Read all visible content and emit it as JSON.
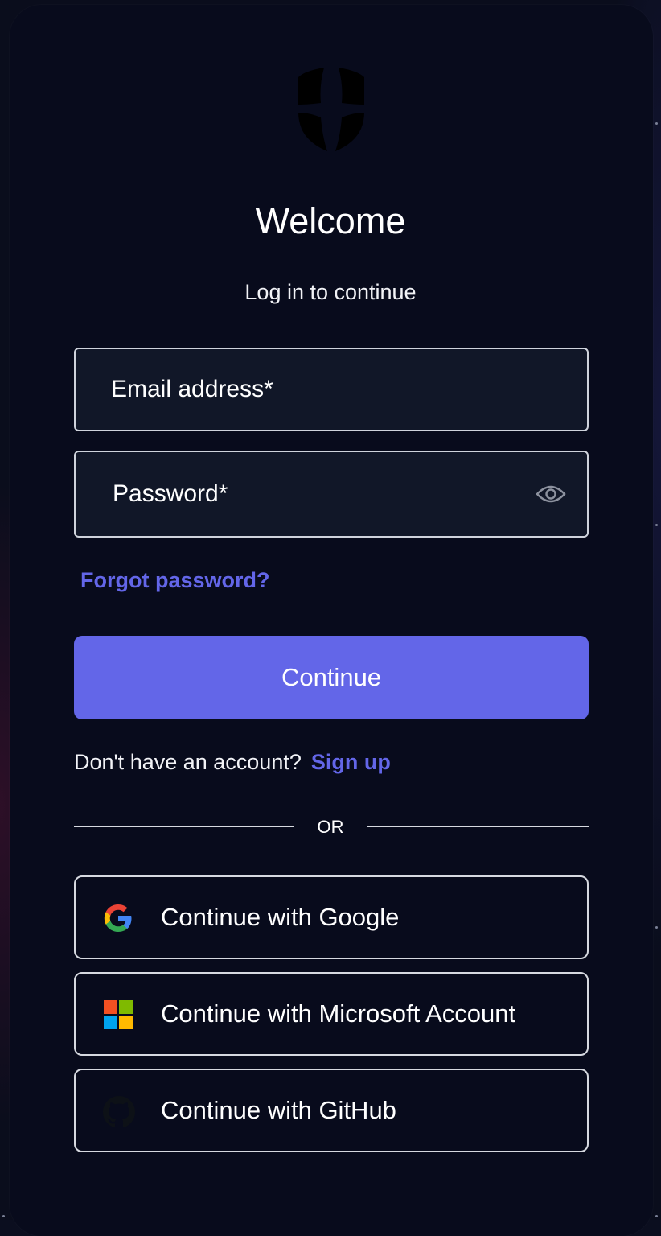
{
  "colors": {
    "accent": "#6366e8",
    "background": "#080b1c",
    "field_background": "#111728",
    "border": "#d6d9e0",
    "text": "#ffffff"
  },
  "header": {
    "logo_icon": "shield-star-logo-icon",
    "title": "Welcome",
    "subtitle": "Log in to continue"
  },
  "form": {
    "email_label": "Email address*",
    "password_label": "Password*",
    "password_toggle_icon": "eye-icon",
    "forgot_password": "Forgot password?",
    "submit_label": "Continue"
  },
  "signup": {
    "prompt": "Don't have an account?",
    "link": "Sign up"
  },
  "divider": {
    "label": "OR"
  },
  "social": [
    {
      "icon": "google-icon",
      "label": "Continue with Google"
    },
    {
      "icon": "microsoft-icon",
      "label": "Continue with Microsoft Account"
    },
    {
      "icon": "github-icon",
      "label": "Continue with GitHub"
    }
  ]
}
